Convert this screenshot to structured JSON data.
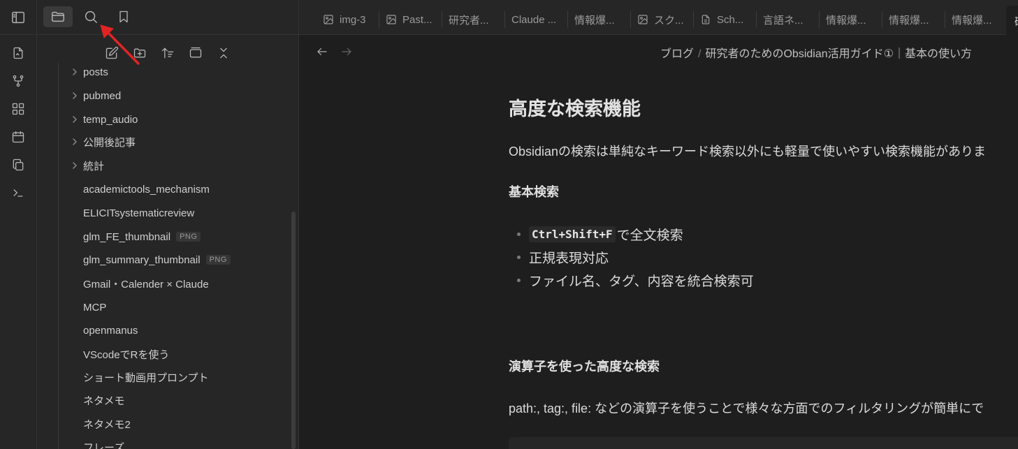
{
  "ribbon": {
    "icons": [
      "sidebar-toggle-icon",
      "open-file-icon",
      "graph-view-icon",
      "canvas-icon",
      "calendar-icon",
      "copy-icon",
      "terminal-icon"
    ]
  },
  "sidebar": {
    "tabs": [
      "file-explorer",
      "search",
      "bookmarks"
    ],
    "actions": [
      "new-note",
      "new-folder",
      "sort",
      "auto-reveal",
      "collapse-all"
    ],
    "tree": [
      {
        "label": "posts",
        "folder": true
      },
      {
        "label": "pubmed",
        "folder": true
      },
      {
        "label": "temp_audio",
        "folder": true
      },
      {
        "label": "公開後記事",
        "folder": true
      },
      {
        "label": "統計",
        "folder": true
      },
      {
        "label": "academictools_mechanism",
        "folder": false
      },
      {
        "label": "ELICITsystematicreview",
        "folder": false
      },
      {
        "label": "glm_FE_thumbnail",
        "folder": false,
        "badge": "PNG"
      },
      {
        "label": "glm_summary_thumbnail",
        "folder": false,
        "badge": "PNG"
      },
      {
        "label": "Gmail・Calender × Claude",
        "folder": false
      },
      {
        "label": "MCP",
        "folder": false
      },
      {
        "label": "openmanus",
        "folder": false
      },
      {
        "label": "VScodeでRを使う",
        "folder": false
      },
      {
        "label": "ショート動画用プロンプト",
        "folder": false
      },
      {
        "label": "ネタメモ",
        "folder": false
      },
      {
        "label": "ネタメモ2",
        "folder": false
      },
      {
        "label": "フレーズ",
        "folder": false
      }
    ]
  },
  "tabs": [
    {
      "label": "img-3",
      "icon": "image"
    },
    {
      "label": "Past...",
      "icon": "image"
    },
    {
      "label": "研究者...",
      "icon": ""
    },
    {
      "label": "Claude ...",
      "icon": ""
    },
    {
      "label": "情報爆...",
      "icon": ""
    },
    {
      "label": "スク...",
      "icon": "image"
    },
    {
      "label": "Sch...",
      "icon": "file"
    },
    {
      "label": "言語ネ...",
      "icon": ""
    },
    {
      "label": "情報爆...",
      "icon": ""
    },
    {
      "label": "情報爆...",
      "icon": ""
    },
    {
      "label": "情報爆...",
      "icon": ""
    }
  ],
  "active_tab": {
    "label": "研"
  },
  "breadcrumb": {
    "folder": "ブログ",
    "sep": "/",
    "title": "研究者のためのObsidian活用ガイド①｜基本の使い方"
  },
  "note": {
    "h2": "高度な検索機能",
    "intro": "Obsidianの検索は単純なキーワード検索以外にも軽量で使いやすい検索機能がありま",
    "h_basic": "基本検索",
    "shortcut_code": "Ctrl+Shift+F",
    "li1_text": "で全文検索",
    "li2": "正規表現対応",
    "li3": "ファイル名、タグ、内容を統合検索可",
    "h_operators": "演算子を使った高度な検索",
    "operators_para": "path:, tag:, file: などの演算子を使うことで様々な方面でのフィルタリングが簡単にで"
  },
  "colors": {
    "bg": "#1e1e1e",
    "sidebar": "#262626",
    "annotation_arrow": "#e02424"
  }
}
